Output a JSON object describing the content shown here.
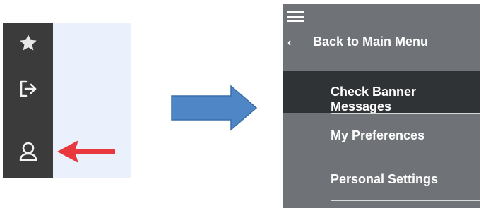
{
  "left_sidebar": {
    "icons": [
      "star-icon",
      "sign-out-icon",
      "user-icon"
    ]
  },
  "menu": {
    "back_label": "Back to Main Menu",
    "back_icon": "chevron-left-icon",
    "items": [
      {
        "label": "Check Banner Messages",
        "active": true
      },
      {
        "label": "My Preferences",
        "active": false
      },
      {
        "label": "Personal Settings",
        "active": false
      }
    ]
  },
  "colors": {
    "sidebar_bg": "#3b3b3b",
    "menu_bg": "#6f7276",
    "active_bg": "#2f3335",
    "red_arrow": "#e8383d",
    "blue_arrow": "#4f86c6"
  }
}
